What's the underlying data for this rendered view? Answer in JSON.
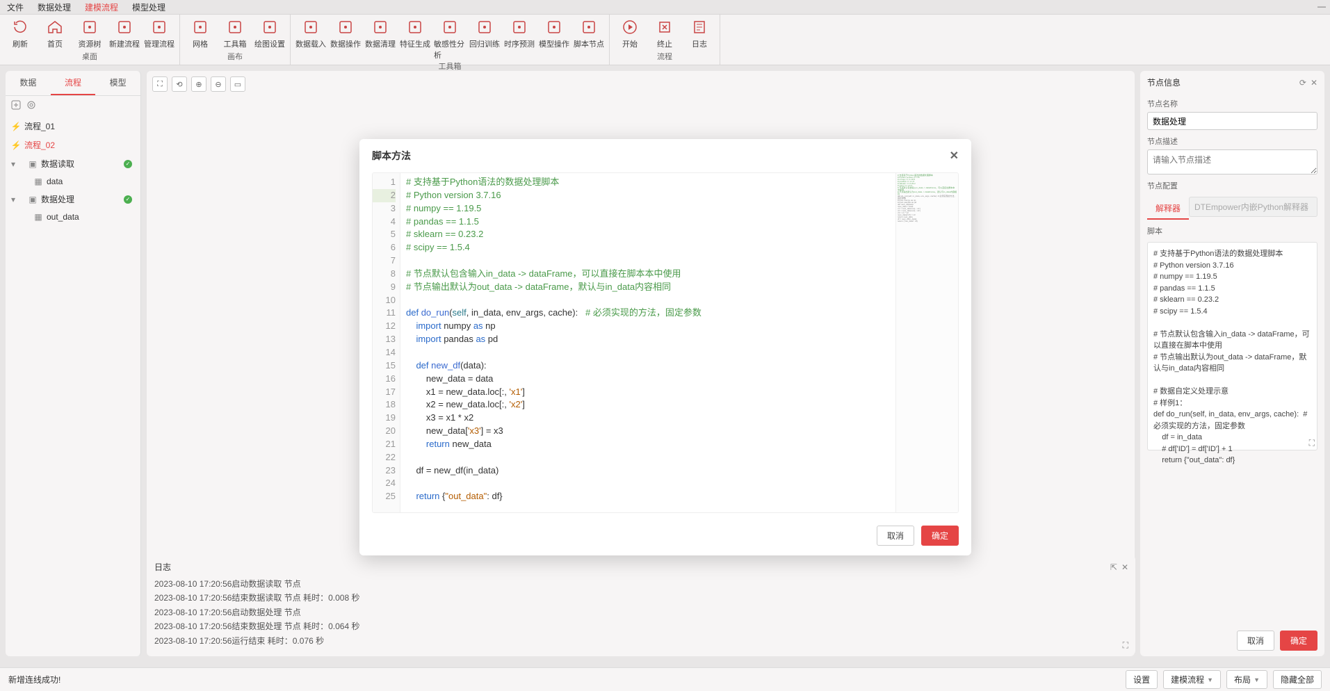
{
  "menubar": [
    "文件",
    "数据处理",
    "建模流程",
    "模型处理"
  ],
  "menubar_active": 2,
  "ribbon": {
    "groups": [
      {
        "label": "桌面",
        "items": [
          {
            "name": "refresh",
            "label": "刷新"
          },
          {
            "name": "home",
            "label": "首页"
          },
          {
            "name": "resource-tree",
            "label": "资源树"
          },
          {
            "name": "new-flow",
            "label": "新建流程"
          },
          {
            "name": "manage-flow",
            "label": "管理流程"
          }
        ]
      },
      {
        "label": "画布",
        "items": [
          {
            "name": "grid",
            "label": "网格"
          },
          {
            "name": "toolbox",
            "label": "工具箱"
          },
          {
            "name": "plot-settings",
            "label": "绘图设置"
          }
        ]
      },
      {
        "label": "工具箱",
        "items": [
          {
            "name": "data-load",
            "label": "数据载入"
          },
          {
            "name": "data-op",
            "label": "数据操作"
          },
          {
            "name": "data-clean",
            "label": "数据清理"
          },
          {
            "name": "feature-gen",
            "label": "特征生成"
          },
          {
            "name": "sensitivity",
            "label": "敏感性分析"
          },
          {
            "name": "reg-train",
            "label": "回归训练"
          },
          {
            "name": "ts-predict",
            "label": "时序预测"
          },
          {
            "name": "model-op",
            "label": "模型操作"
          },
          {
            "name": "script-node",
            "label": "脚本节点"
          }
        ]
      },
      {
        "label": "流程",
        "items": [
          {
            "name": "start",
            "label": "开始"
          },
          {
            "name": "stop",
            "label": "终止"
          },
          {
            "name": "log",
            "label": "日志"
          }
        ]
      }
    ]
  },
  "side": {
    "tabs": [
      "数据",
      "流程",
      "模型"
    ],
    "active_tab": 1,
    "flows": [
      "流程_01",
      "流程_02"
    ],
    "active_flow": 1,
    "nodes": [
      {
        "label": "数据读取",
        "children": [
          "data"
        ],
        "status": "ok"
      },
      {
        "label": "数据处理",
        "children": [
          "out_data"
        ],
        "status": "ok"
      }
    ]
  },
  "node_info": {
    "title": "节点信息",
    "name_label": "节点名称",
    "name_value": "数据处理",
    "desc_label": "节点描述",
    "desc_placeholder": "请输入节点描述",
    "config_label": "节点配置",
    "interpreter_tab": "解释器",
    "interpreter_display": "DTEmpower内嵌Python解释器",
    "script_label": "脚本",
    "script_preview": "# 支持基于Python语法的数据处理脚本\n# Python version 3.7.16\n# numpy == 1.19.5\n# pandas == 1.1.5\n# sklearn == 0.23.2\n# scipy == 1.5.4\n\n# 节点默认包含输入in_data -> dataFrame，可以直接在脚本中使用\n# 节点输出默认为out_data -> dataFrame，默认与in_data内容相同\n\n# 数据自定义处理示意\n# 样例1：\ndef do_run(self, in_data, env_args, cache):  # 必须实现的方法，固定参数\n    df = in_data\n    # df['ID'] = df['ID'] + 1\n    return {\"out_data\": df}",
    "cancel": "取消",
    "confirm": "确定"
  },
  "log": {
    "title": "日志",
    "lines": [
      "2023-08-10 17:20:56启动数据读取 节点",
      "2023-08-10 17:20:56结束数据读取 节点 耗时：0.008 秒",
      "2023-08-10 17:20:56启动数据处理 节点",
      "2023-08-10 17:20:56结束数据处理 节点 耗时：0.064 秒",
      "2023-08-10 17:20:56运行结束 耗时：0.076 秒"
    ]
  },
  "status": {
    "message": "新增连线成功!",
    "buttons": [
      "设置",
      "建模流程",
      "布局",
      "隐藏全部"
    ]
  },
  "modal": {
    "title": "脚本方法",
    "cancel": "取消",
    "confirm": "确定",
    "code_lines": [
      {
        "n": 1,
        "t": "comment",
        "text": "# 支持基于Python语法的数据处理脚本"
      },
      {
        "n": 2,
        "t": "comment",
        "text": "# Python version 3.7.16"
      },
      {
        "n": 3,
        "t": "comment",
        "text": "# numpy == 1.19.5"
      },
      {
        "n": 4,
        "t": "comment",
        "text": "# pandas == 1.1.5"
      },
      {
        "n": 5,
        "t": "comment",
        "text": "# sklearn == 0.23.2"
      },
      {
        "n": 6,
        "t": "comment",
        "text": "# scipy == 1.5.4"
      },
      {
        "n": 7,
        "t": "blank",
        "text": ""
      },
      {
        "n": 8,
        "t": "comment",
        "text": "# 节点默认包含输入in_data -> dataFrame，可以直接在脚本本中使用"
      },
      {
        "n": 9,
        "t": "comment",
        "text": "# 节点输出默认为out_data -> dataFrame，默认与in_data内容相同"
      },
      {
        "n": 10,
        "t": "blank",
        "text": ""
      },
      {
        "n": 11,
        "t": "def",
        "text": "def do_run(self, in_data, env_args, cache):   # 必须实现的方法，固定参数"
      },
      {
        "n": 12,
        "t": "import",
        "text": "    import numpy as np"
      },
      {
        "n": 13,
        "t": "import",
        "text": "    import pandas as pd"
      },
      {
        "n": 14,
        "t": "blank",
        "text": ""
      },
      {
        "n": 15,
        "t": "def2",
        "text": "    def new_df(data):"
      },
      {
        "n": 16,
        "t": "code",
        "text": "        new_data = data"
      },
      {
        "n": 17,
        "t": "loc",
        "text": "        x1 = new_data.loc[:, 'x1']"
      },
      {
        "n": 18,
        "t": "loc",
        "text": "        x2 = new_data.loc[:, 'x2']"
      },
      {
        "n": 19,
        "t": "code",
        "text": "        x3 = x1 * x2"
      },
      {
        "n": 20,
        "t": "str",
        "text": "        new_data['x3'] = x3"
      },
      {
        "n": 21,
        "t": "return",
        "text": "        return new_data"
      },
      {
        "n": 22,
        "t": "blank",
        "text": ""
      },
      {
        "n": 23,
        "t": "code",
        "text": "    df = new_df(in_data)"
      },
      {
        "n": 24,
        "t": "blank",
        "text": ""
      },
      {
        "n": 25,
        "t": "return2",
        "text": "    return {\"out_data\": df}"
      }
    ]
  }
}
